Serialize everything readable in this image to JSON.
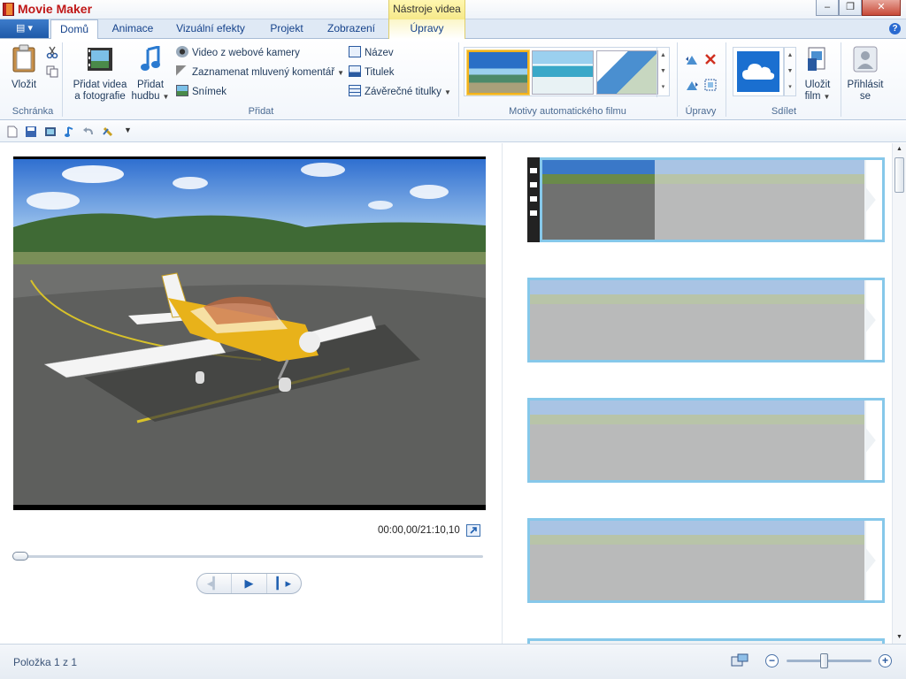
{
  "window": {
    "title": "Movie Maker",
    "context_header": "Nástroje videa",
    "controls": [
      "‒",
      "❐",
      "✕"
    ]
  },
  "tabs": [
    {
      "label": "Domů",
      "active": true
    },
    {
      "label": "Animace"
    },
    {
      "label": "Vizuální efekty"
    },
    {
      "label": "Projekt"
    },
    {
      "label": "Zobrazení"
    },
    {
      "label": "Úpravy",
      "context": true
    }
  ],
  "ribbon": {
    "clipboard": {
      "paste_label": "Vložit",
      "group_label": "Schránka"
    },
    "add": {
      "add_video_label_1": "Přidat videa",
      "add_video_label_2": "a fotografie",
      "add_music_label_1": "Přidat",
      "add_music_label_2": "hudbu",
      "webcam_label": "Video z webové kamery",
      "narration_label": "Zaznamenat mluvený komentář",
      "snapshot_label": "Snímek",
      "title_label": "Název",
      "caption_label": "Titulek",
      "credits_label": "Závěrečné titulky",
      "group_label": "Přidat"
    },
    "themes": {
      "group_label": "Motivy automatického filmu"
    },
    "editing": {
      "group_label": "Úpravy"
    },
    "share": {
      "save_label_1": "Uložit",
      "save_label_2": "film",
      "group_label": "Sdílet"
    },
    "signin": {
      "label_1": "Přihlásit",
      "label_2": "se"
    }
  },
  "player": {
    "time": "00:00,00/21:10,10",
    "progress": 0
  },
  "storyboard": {
    "clip_count_visible": 5
  },
  "status": {
    "item_text": "Položka 1 z 1",
    "zoom_level": 0.45
  },
  "colors": {
    "accent": "#2a6fc6",
    "selection": "#86c8ea",
    "title_red": "#c01818"
  }
}
